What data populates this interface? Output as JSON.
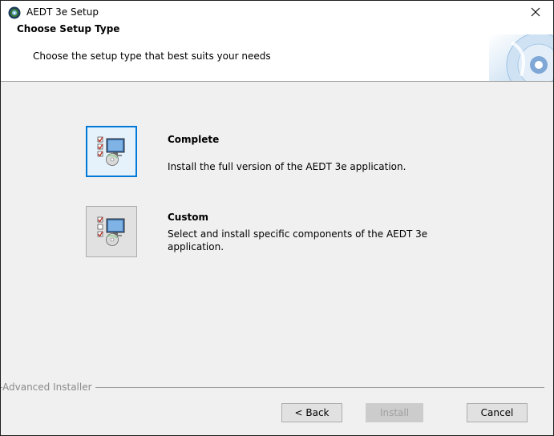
{
  "window": {
    "title": "AEDT 3e Setup"
  },
  "banner": {
    "title": "Choose Setup Type",
    "subtitle": "Choose the setup type that best suits your needs"
  },
  "options": [
    {
      "title": "Complete",
      "description": "Install the full version of the AEDT 3e application."
    },
    {
      "title": "Custom",
      "description": "Select and install specific components of the AEDT 3e application."
    }
  ],
  "footer": {
    "brand": "Advanced Installer",
    "back_label": "< Back",
    "install_label": "Install",
    "cancel_label": "Cancel"
  },
  "icons": {
    "app": "aedt-globe-icon",
    "close": "close-icon",
    "banner": "cd-disc-icon",
    "complete": "complete-setup-icon",
    "custom": "custom-setup-icon"
  },
  "colors": {
    "accent": "#0078d7",
    "check_red": "#c0392b"
  }
}
